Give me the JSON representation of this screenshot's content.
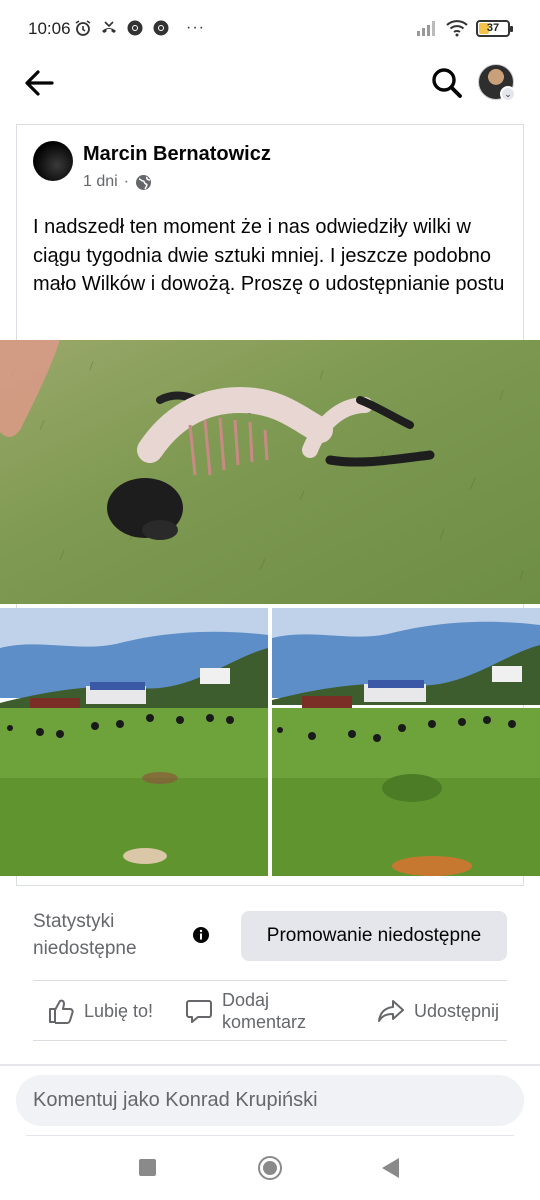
{
  "status_bar": {
    "time": "10:06",
    "more": "···",
    "battery_level": 37,
    "battery_text": "37"
  },
  "header": {
    "back_icon": "arrow-left-icon",
    "search_icon": "search-icon"
  },
  "post": {
    "author": "Marcin Bernatowicz",
    "age": "1 dni",
    "separator": "·",
    "audience_icon": "globe-icon",
    "text": "I nadszedł ten moment że i nas odwiedziły wilki w ciągu tygodnia dwie sztuki mniej. I jeszcze podobno mało Wilków i dowożą. Proszę o udostępnianie postu"
  },
  "insights": {
    "stats_label": "Statystyki niedostępne",
    "promote_button": "Promowanie niedostępne"
  },
  "actions": {
    "like": "Lubię to!",
    "comment_line1": "Dodaj",
    "comment_line2": "komentarz",
    "share": "Udostępnij"
  },
  "comment_box": {
    "placeholder": "Komentuj jako Konrad Krupiński"
  },
  "colors": {
    "secondary_text": "#65676b",
    "button_bg": "#e4e6eb",
    "input_bg": "#f0f2f5",
    "battery_fill": "#f3c34a"
  }
}
